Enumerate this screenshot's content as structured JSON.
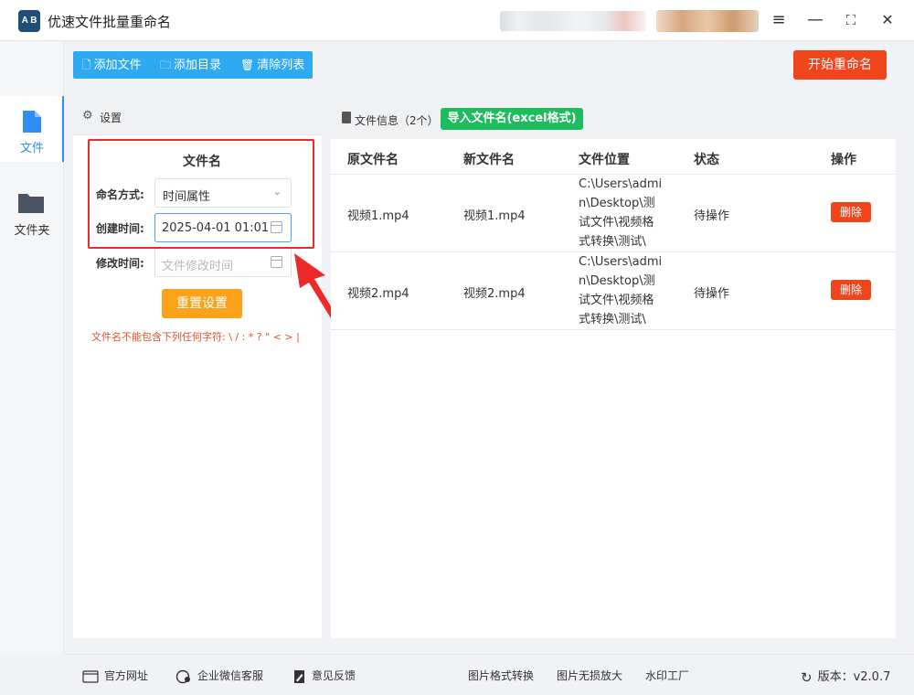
{
  "app": {
    "title": "优速文件批量重命名",
    "logo_text": "A B"
  },
  "window_controls": {
    "menu": "≡",
    "minimize": "—",
    "maximize": "⛶",
    "close": "✕"
  },
  "nav": {
    "items": [
      {
        "label": "文件",
        "icon": "file-icon",
        "active": true
      },
      {
        "label": "文件夹",
        "icon": "folder-icon",
        "active": false
      }
    ]
  },
  "toolbar": {
    "add_file": "添加文件",
    "add_dir": "添加目录",
    "clear_list": "清除列表",
    "start": "开始重命名"
  },
  "settings": {
    "title": "设置",
    "section": "文件名",
    "naming_mode_label": "命名方式:",
    "naming_mode_value": "时间属性",
    "created_label": "创建时间:",
    "created_value": "2025-04-01 01:01",
    "modified_label": "修改时间:",
    "modified_placeholder": "文件修改时间",
    "reset": "重置设置",
    "warning": "文件名不能包含下列任何字符: \\ / : * ? \" < > |"
  },
  "files": {
    "title": "文件信息（2个）",
    "import_button": "导入文件名(excel格式)",
    "columns": [
      "原文件名",
      "新文件名",
      "文件位置",
      "状态",
      "操作"
    ],
    "rows": [
      {
        "orig": "视频1.mp4",
        "new": "视频1.mp4",
        "path": "C:\\Users\\admin\\Desktop\\测试文件\\视频格式转换\\测试\\",
        "status": "待操作",
        "action": "删除"
      },
      {
        "orig": "视频2.mp4",
        "new": "视频2.mp4",
        "path": "C:\\Users\\admin\\Desktop\\测试文件\\视频格式转换\\测试\\",
        "status": "待操作",
        "action": "删除"
      }
    ]
  },
  "footer": {
    "website": "官方网址",
    "wechat": "企业微信客服",
    "feedback": "意见反馈",
    "img_convert": "图片格式转换",
    "img_enlarge": "图片无损放大",
    "watermark": "水印工厂",
    "version": "版本：v2.0.7"
  },
  "colors": {
    "toolbar_blue": "#2eaaf2",
    "start_red": "#f0441b",
    "import_green": "#1fbc5f",
    "reset_orange": "#fba11a",
    "highlight_red": "#ec2a2a",
    "active_blue": "#2f8ef5"
  }
}
